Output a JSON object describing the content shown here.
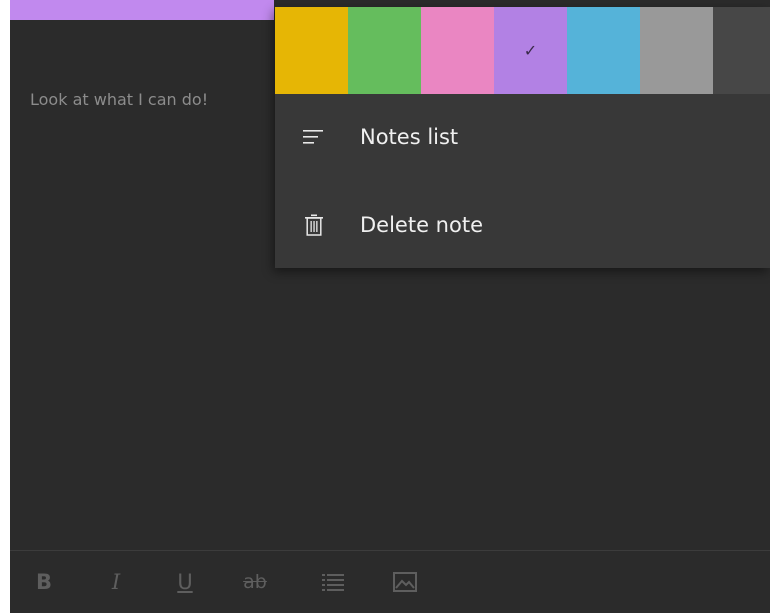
{
  "note": {
    "accent_color": "#c189ee",
    "text": "Look at what I can do!"
  },
  "menu": {
    "swatches": [
      {
        "name": "yellow",
        "color": "#e6b605",
        "selected": false
      },
      {
        "name": "green",
        "color": "#65bd5d",
        "selected": false
      },
      {
        "name": "pink",
        "color": "#ea86c2",
        "selected": false
      },
      {
        "name": "purple",
        "color": "#b281e4",
        "selected": true
      },
      {
        "name": "blue",
        "color": "#55b3d9",
        "selected": false
      },
      {
        "name": "gray",
        "color": "#999999",
        "selected": false
      },
      {
        "name": "charcoal",
        "color": "#474747",
        "selected": false
      }
    ],
    "check_glyph": "✓",
    "items": [
      {
        "label": "Notes list",
        "icon": "list-icon"
      },
      {
        "label": "Delete note",
        "icon": "trash-icon"
      }
    ]
  },
  "toolbar": {
    "bold_label": "B",
    "italic_label": "I",
    "underline_label": "U",
    "strike_label": "ab",
    "list_icon": "bullet-list-icon",
    "image_icon": "image-icon"
  }
}
